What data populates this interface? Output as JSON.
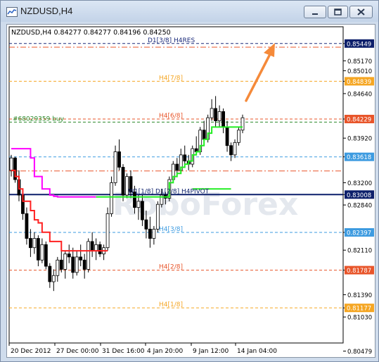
{
  "window": {
    "title": "NZDUSD,H4",
    "buttons": [
      "minimize",
      "maximize",
      "close"
    ]
  },
  "chart_data": {
    "type": "candlestick",
    "symbol_info": "NZDUSD,H4  0.84277 0.84277 0.84196 0.84250",
    "ylim": [
      0.8061,
      0.8572
    ],
    "y_ticks": [
      {
        "label": "0.85449",
        "value": 0.85449,
        "highlight": "dark"
      },
      {
        "label": "0.85170",
        "value": 0.8517
      },
      {
        "label": "0.85010",
        "value": 0.8501
      },
      {
        "label": "0.84839",
        "value": 0.84839,
        "highlight": "#f5a623"
      },
      {
        "label": "0.84640",
        "value": 0.8464
      },
      {
        "label": "0.84229",
        "value": 0.84229,
        "highlight": "#e8552a"
      },
      {
        "label": "0.83920",
        "value": 0.8392
      },
      {
        "label": "0.83618",
        "value": 0.83618,
        "highlight": "#3d9be0"
      },
      {
        "label": "0.83200",
        "value": 0.832
      },
      {
        "label": "0.83008",
        "value": 0.83008,
        "highlight": "#0c1f6b"
      },
      {
        "label": "0.82840",
        "value": 0.8284
      },
      {
        "label": "0.82397",
        "value": 0.82397,
        "highlight": "#3d9be0"
      },
      {
        "label": "0.82110",
        "value": 0.8211
      },
      {
        "label": "0.81787",
        "value": 0.81787,
        "highlight": "#e8552a"
      },
      {
        "label": "0.81390",
        "value": 0.8139
      },
      {
        "label": "0.81177",
        "value": 0.81177,
        "highlight": "#f5a623"
      },
      {
        "label": "0.81030",
        "value": 0.8103
      },
      {
        "label": "0.80479",
        "value": 0.80479
      }
    ],
    "x_ticks": [
      "20 Dec 2012",
      "27 Dec 00:00",
      "31 Dec 16:00",
      "4 Jan 20:00",
      "9 Jan 12:00",
      "14 Jan 04:00"
    ],
    "levels": [
      {
        "name": "D1[3/8] H4RES",
        "value": 0.85449,
        "color": "#1a2a7a",
        "style": "dashed"
      },
      {
        "name": "",
        "value": 0.8539,
        "color": "#e8552a",
        "style": "dashdot"
      },
      {
        "name": "H4[7/8]",
        "value": 0.84839,
        "color": "#f5a623",
        "style": "dashed"
      },
      {
        "name": "H4[6/8]",
        "value": 0.84229,
        "color": "#e8552a",
        "style": "dashed"
      },
      {
        "name": "#68029359 buy",
        "value": 0.8418,
        "color": "#2a8a2a",
        "style": "dashed"
      },
      {
        "name": "",
        "value": 0.83618,
        "color": "#3d9be0",
        "style": "dashed"
      },
      {
        "name": "",
        "value": 0.8339,
        "color": "#e8552a",
        "style": "dashdot"
      },
      {
        "name": "W1[1/8] D1[2/8] H4PIVOT",
        "value": 0.83008,
        "color": "#0c1f6b",
        "style": "solid"
      },
      {
        "name": "H4[3/8]",
        "value": 0.82397,
        "color": "#3d9be0",
        "style": "dashed"
      },
      {
        "name": "H4[2/8]",
        "value": 0.81787,
        "color": "#e8552a",
        "style": "dashed"
      },
      {
        "name": "H4[1/8]",
        "value": 0.81177,
        "color": "#f5a623",
        "style": "dashed"
      }
    ],
    "candles": [
      [
        0.834,
        0.8365,
        0.833,
        0.836
      ],
      [
        0.836,
        0.8362,
        0.832,
        0.8325
      ],
      [
        0.8325,
        0.834,
        0.829,
        0.83
      ],
      [
        0.83,
        0.831,
        0.826,
        0.827
      ],
      [
        0.827,
        0.828,
        0.822,
        0.823
      ],
      [
        0.823,
        0.8245,
        0.82,
        0.8215
      ],
      [
        0.8215,
        0.824,
        0.8205,
        0.823
      ],
      [
        0.823,
        0.8235,
        0.8185,
        0.8195
      ],
      [
        0.8195,
        0.823,
        0.819,
        0.822
      ],
      [
        0.822,
        0.8225,
        0.818,
        0.8185
      ],
      [
        0.8185,
        0.819,
        0.815,
        0.816
      ],
      [
        0.816,
        0.818,
        0.8145,
        0.817
      ],
      [
        0.817,
        0.82,
        0.816,
        0.8195
      ],
      [
        0.8195,
        0.8215,
        0.8175,
        0.818
      ],
      [
        0.818,
        0.821,
        0.8165,
        0.8205
      ],
      [
        0.8205,
        0.822,
        0.819,
        0.82
      ],
      [
        0.82,
        0.8215,
        0.8165,
        0.8175
      ],
      [
        0.8175,
        0.821,
        0.817,
        0.82
      ],
      [
        0.82,
        0.822,
        0.8185,
        0.8195
      ],
      [
        0.8195,
        0.8205,
        0.8165,
        0.818
      ],
      [
        0.818,
        0.823,
        0.8175,
        0.8225
      ],
      [
        0.8225,
        0.824,
        0.82,
        0.821
      ],
      [
        0.821,
        0.823,
        0.8195,
        0.822
      ],
      [
        0.822,
        0.8225,
        0.82,
        0.8205
      ],
      [
        0.8205,
        0.822,
        0.8195,
        0.8215
      ],
      [
        0.8215,
        0.828,
        0.821,
        0.827
      ],
      [
        0.827,
        0.833,
        0.8265,
        0.832
      ],
      [
        0.832,
        0.838,
        0.8315,
        0.837
      ],
      [
        0.837,
        0.839,
        0.834,
        0.8345
      ],
      [
        0.8345,
        0.835,
        0.829,
        0.83
      ],
      [
        0.83,
        0.8335,
        0.8295,
        0.833
      ],
      [
        0.833,
        0.834,
        0.8295,
        0.8305
      ],
      [
        0.8305,
        0.8315,
        0.827,
        0.828
      ],
      [
        0.828,
        0.83,
        0.826,
        0.829
      ],
      [
        0.829,
        0.83,
        0.825,
        0.826
      ],
      [
        0.826,
        0.8275,
        0.823,
        0.8245
      ],
      [
        0.8245,
        0.8265,
        0.8215,
        0.823
      ],
      [
        0.823,
        0.825,
        0.822,
        0.8245
      ],
      [
        0.8245,
        0.829,
        0.824,
        0.8285
      ],
      [
        0.8285,
        0.831,
        0.828,
        0.83
      ],
      [
        0.83,
        0.8305,
        0.8285,
        0.8295
      ],
      [
        0.8295,
        0.833,
        0.829,
        0.8325
      ],
      [
        0.8325,
        0.8355,
        0.832,
        0.835
      ],
      [
        0.835,
        0.836,
        0.8335,
        0.834
      ],
      [
        0.834,
        0.8375,
        0.8335,
        0.8365
      ],
      [
        0.8365,
        0.838,
        0.835,
        0.8355
      ],
      [
        0.8355,
        0.8365,
        0.834,
        0.835
      ],
      [
        0.835,
        0.838,
        0.8345,
        0.8375
      ],
      [
        0.8375,
        0.8395,
        0.8365,
        0.837
      ],
      [
        0.837,
        0.841,
        0.8365,
        0.8405
      ],
      [
        0.8405,
        0.842,
        0.8385,
        0.839
      ],
      [
        0.839,
        0.843,
        0.8385,
        0.8425
      ],
      [
        0.8425,
        0.8455,
        0.842,
        0.844
      ],
      [
        0.844,
        0.846,
        0.841,
        0.842
      ],
      [
        0.842,
        0.8445,
        0.841,
        0.8435
      ],
      [
        0.8435,
        0.844,
        0.84,
        0.841
      ],
      [
        0.841,
        0.842,
        0.837,
        0.838
      ],
      [
        0.838,
        0.8385,
        0.8355,
        0.8365
      ],
      [
        0.8365,
        0.839,
        0.836,
        0.8385
      ],
      [
        0.8385,
        0.841,
        0.838,
        0.8405
      ],
      [
        0.8405,
        0.843,
        0.84,
        0.8425
      ]
    ],
    "indicator_lines": [
      {
        "color": "#ff2020",
        "values": [
          0.834,
          0.833,
          0.831,
          0.829,
          0.829,
          0.8275,
          0.826,
          0.8255,
          0.824,
          0.824,
          0.8225,
          0.8225,
          0.8225,
          0.821,
          0.821,
          0.821,
          0.821,
          0.821,
          0.821,
          0.821,
          0.821,
          0.821,
          0.821,
          0.821,
          0.821,
          0.821
        ]
      },
      {
        "color": "#ff00ff",
        "values": [
          0.8375,
          0.8375,
          0.8375,
          0.8375,
          0.8375,
          0.836,
          0.833,
          0.833,
          0.831,
          0.831,
          0.83,
          0.8298,
          0.8297,
          0.8297,
          0.8297,
          0.8297,
          0.8297,
          0.8297,
          0.8297,
          0.8297,
          0.8297,
          0.8297,
          0.8297
        ]
      },
      {
        "color": "#22ee22",
        "values": [
          null,
          null,
          null,
          null,
          null,
          null,
          null,
          null,
          null,
          null,
          null,
          null,
          null,
          null,
          null,
          null,
          null,
          null,
          null,
          null,
          null,
          null,
          0.8297,
          0.8297,
          0.8297,
          0.8297,
          0.8297,
          0.8297,
          0.8297,
          0.8297,
          0.8297,
          0.8297,
          0.8297,
          0.8297,
          0.8297,
          0.8297,
          0.8297,
          0.8297,
          0.8297,
          0.8297,
          0.8297,
          0.832,
          0.833,
          0.8335,
          0.8345,
          0.835,
          0.8355,
          0.8365,
          0.837,
          0.838,
          0.839,
          0.84,
          0.841,
          0.841,
          0.841,
          0.841,
          0.841,
          0.841,
          0.841,
          0.841,
          0.841
        ]
      },
      {
        "color": "#22ee22",
        "values": [
          null,
          null,
          null,
          null,
          null,
          null,
          null,
          null,
          null,
          null,
          null,
          null,
          null,
          null,
          null,
          null,
          null,
          null,
          null,
          null,
          null,
          null,
          null,
          null,
          null,
          null,
          null,
          null,
          null,
          null,
          null,
          null,
          null,
          null,
          null,
          null,
          null,
          null,
          null,
          null,
          null,
          null,
          null,
          null,
          null,
          null,
          null,
          0.831,
          0.831,
          0.831,
          0.831,
          0.831,
          0.831,
          0.831,
          0.831,
          0.831,
          0.831,
          0.831
        ]
      }
    ],
    "forecast_arrow": {
      "color": "#f58a3a",
      "direction": "up"
    },
    "watermark": "RoboForex"
  }
}
